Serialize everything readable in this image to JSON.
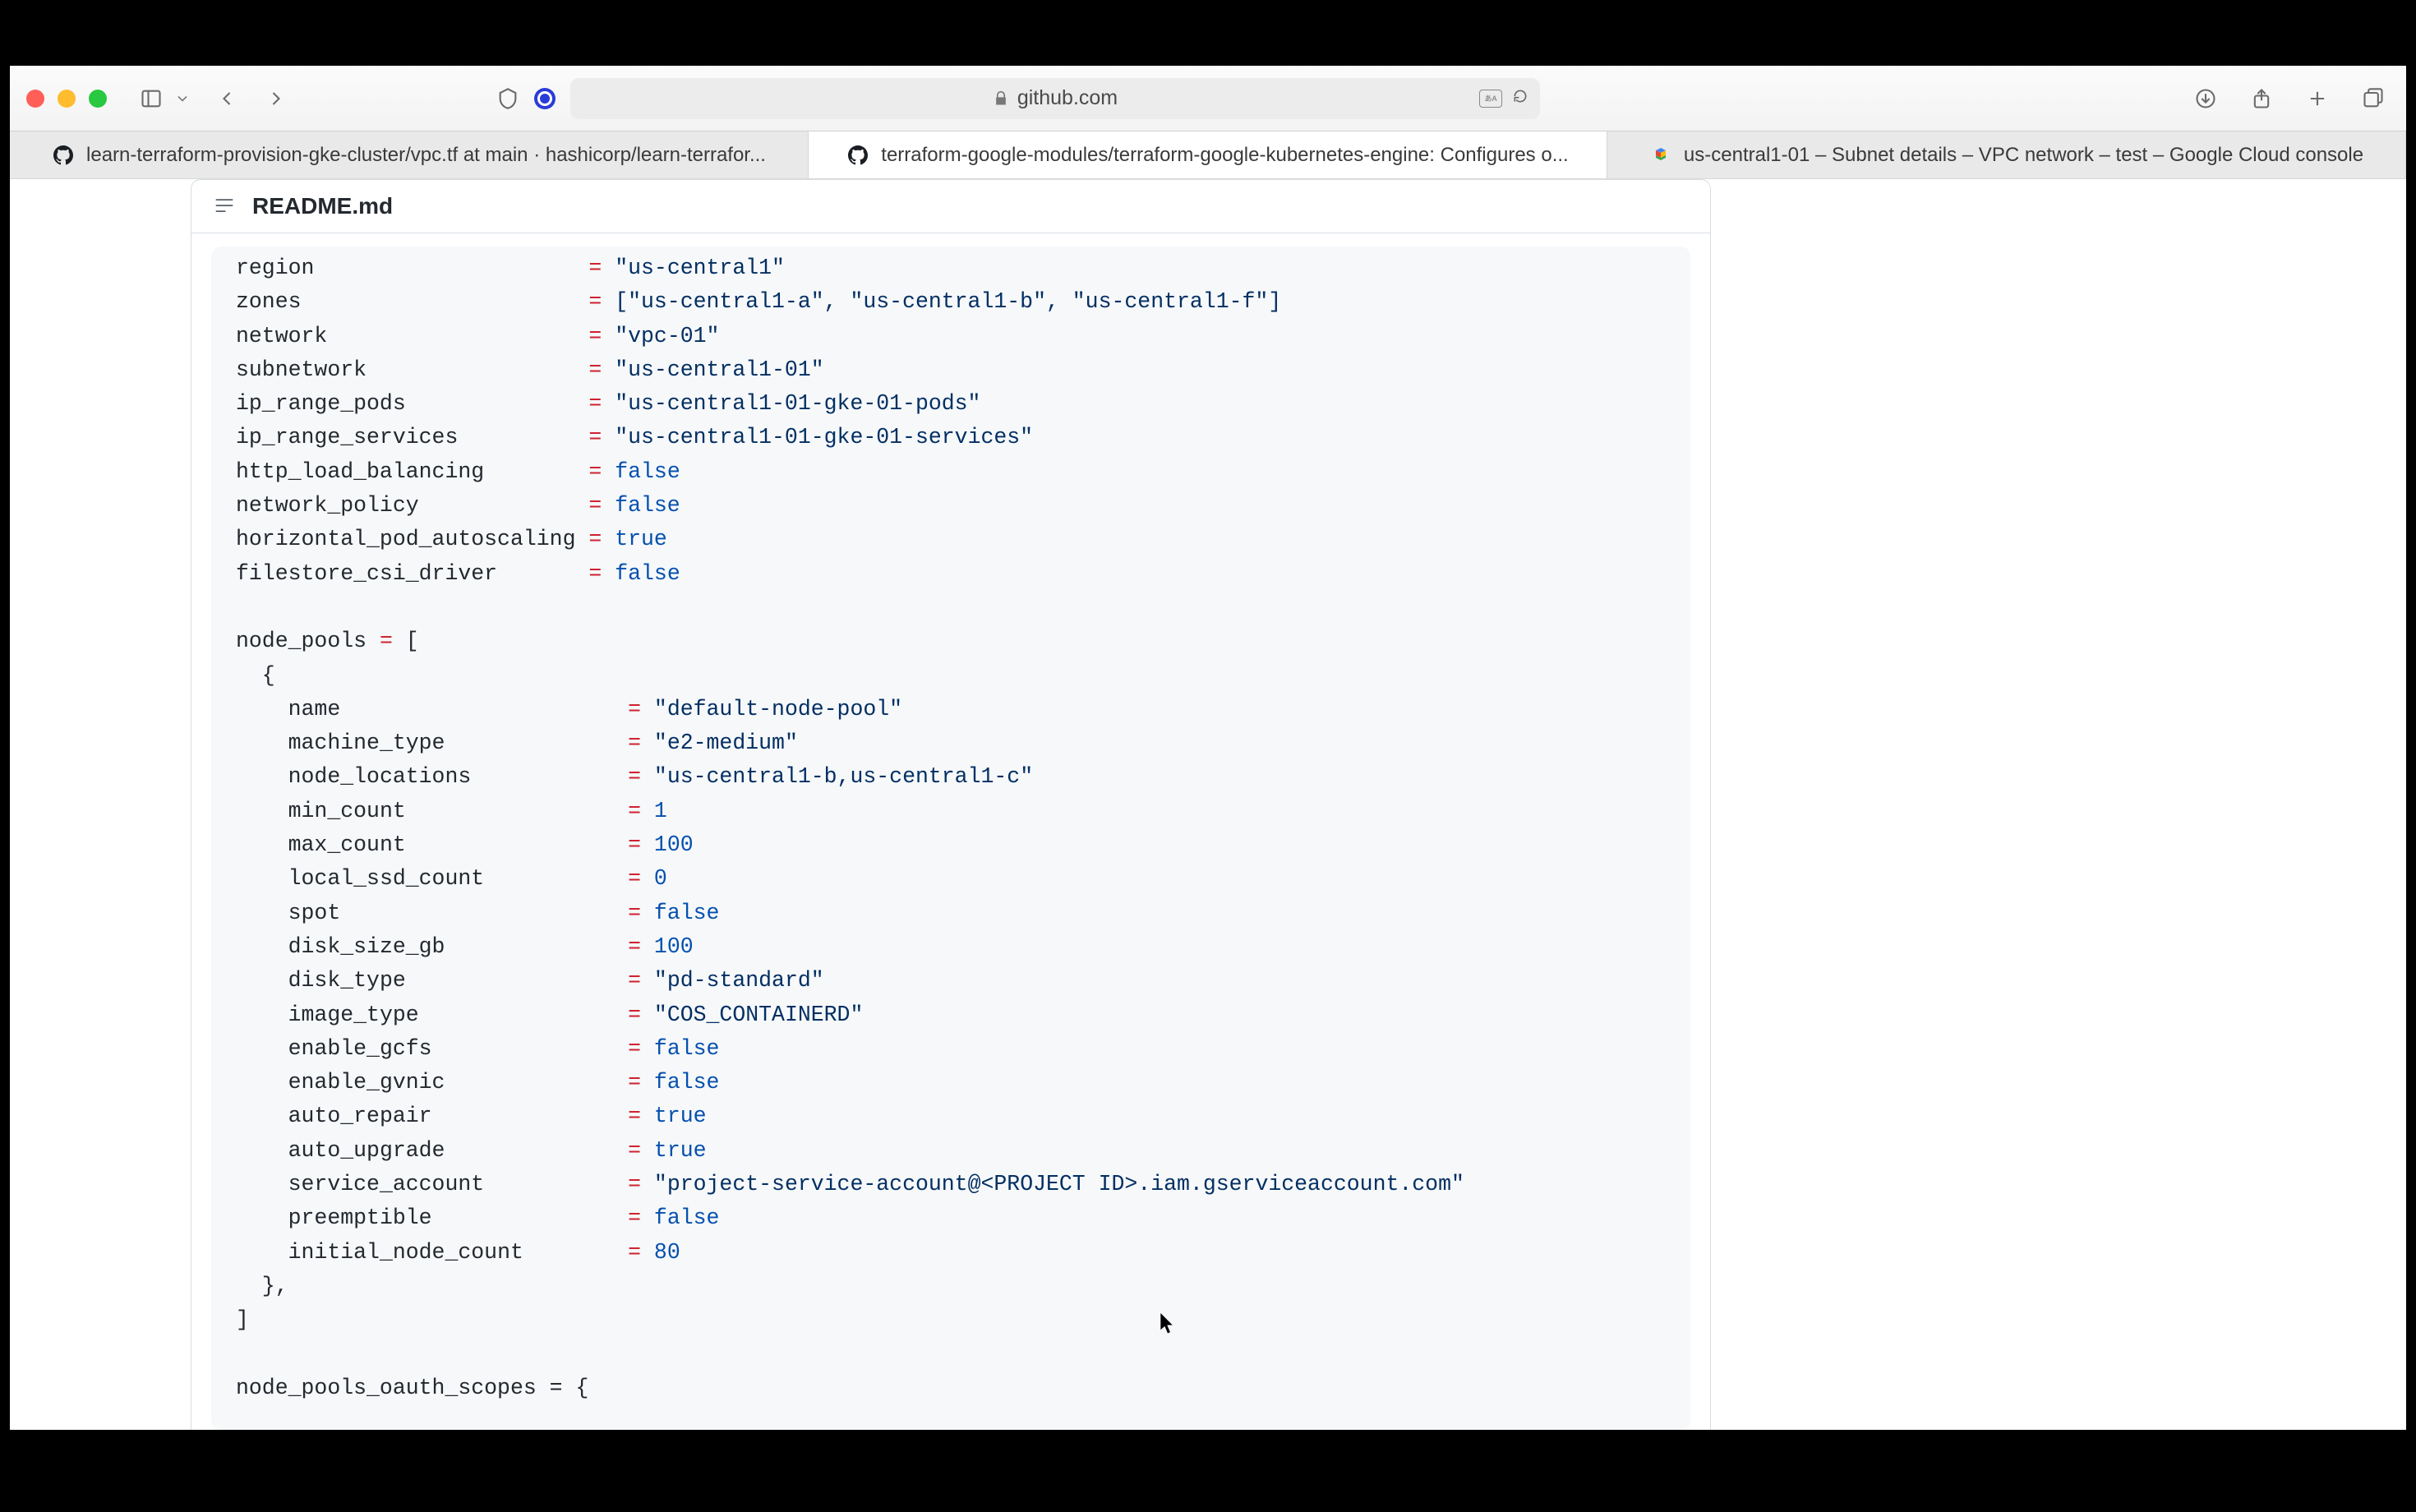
{
  "browser": {
    "url_host": "github.com",
    "tabs": [
      {
        "title": "learn-terraform-provision-gke-cluster/vpc.tf at main · hashicorp/learn-terrafor...",
        "icon": "github"
      },
      {
        "title": "terraform-google-modules/terraform-google-kubernetes-engine: Configures o...",
        "icon": "github",
        "active": true
      },
      {
        "title": "us-central1-01 – Subnet details – VPC network – test – Google Cloud console",
        "icon": "gcp"
      }
    ]
  },
  "readme": {
    "filename": "README.md"
  },
  "terraform": {
    "region": {
      "key": "region",
      "value": "\"us-central1\""
    },
    "zones": {
      "key": "zones",
      "value": "[\"us-central1-a\", \"us-central1-b\", \"us-central1-f\"]"
    },
    "network": {
      "key": "network",
      "value": "\"vpc-01\""
    },
    "subnetwork": {
      "key": "subnetwork",
      "value": "\"us-central1-01\""
    },
    "ip_range_pods": {
      "key": "ip_range_pods",
      "value": "\"us-central1-01-gke-01-pods\""
    },
    "ip_range_services": {
      "key": "ip_range_services",
      "value": "\"us-central1-01-gke-01-services\""
    },
    "http_load_balancing": {
      "key": "http_load_balancing",
      "value": "false"
    },
    "network_policy": {
      "key": "network_policy",
      "value": "false"
    },
    "horizontal_pod_autoscaling": {
      "key": "horizontal_pod_autoscaling",
      "value": "true"
    },
    "filestore_csi_driver": {
      "key": "filestore_csi_driver",
      "value": "false"
    },
    "node_pools_key": "node_pools",
    "node_pool": {
      "name": {
        "key": "name",
        "value": "\"default-node-pool\""
      },
      "machine_type": {
        "key": "machine_type",
        "value": "\"e2-medium\""
      },
      "node_locations": {
        "key": "node_locations",
        "value": "\"us-central1-b,us-central1-c\""
      },
      "min_count": {
        "key": "min_count",
        "value": "1"
      },
      "max_count": {
        "key": "max_count",
        "value": "100"
      },
      "local_ssd_count": {
        "key": "local_ssd_count",
        "value": "0"
      },
      "spot": {
        "key": "spot",
        "value": "false"
      },
      "disk_size_gb": {
        "key": "disk_size_gb",
        "value": "100"
      },
      "disk_type": {
        "key": "disk_type",
        "value": "\"pd-standard\""
      },
      "image_type": {
        "key": "image_type",
        "value": "\"COS_CONTAINERD\""
      },
      "enable_gcfs": {
        "key": "enable_gcfs",
        "value": "false"
      },
      "enable_gvnic": {
        "key": "enable_gvnic",
        "value": "false"
      },
      "auto_repair": {
        "key": "auto_repair",
        "value": "true"
      },
      "auto_upgrade": {
        "key": "auto_upgrade",
        "value": "true"
      },
      "service_account": {
        "key": "service_account",
        "value": "\"project-service-account@<PROJECT ID>.iam.gserviceaccount.com\""
      },
      "preemptible": {
        "key": "preemptible",
        "value": "false"
      },
      "initial_node_count": {
        "key": "initial_node_count",
        "value": "80"
      }
    },
    "next_block": "node_pools_oauth_scopes = {"
  }
}
